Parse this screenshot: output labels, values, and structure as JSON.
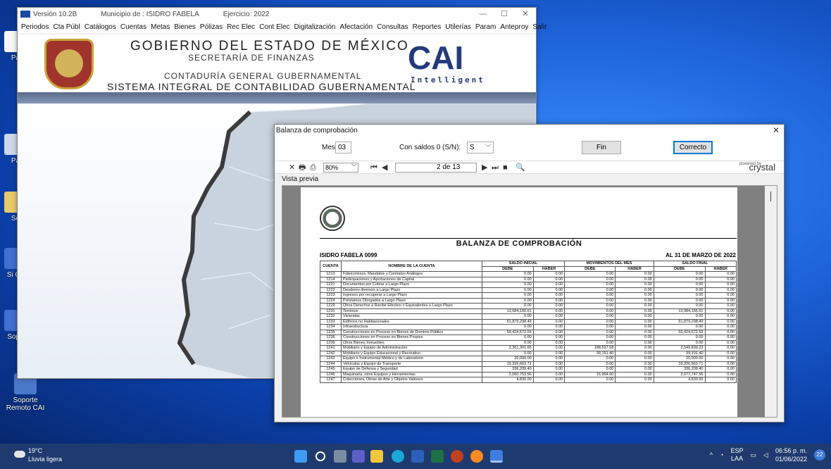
{
  "main_window": {
    "version": "Versión 10.2B",
    "municipio": "Municipio de : ISIDRO FABELA",
    "ejercicio": "Ejercicio: 2022",
    "menu": [
      "Periodos",
      "Cta Públ",
      "Catálogos",
      "Cuentas",
      "Metas",
      "Bienes",
      "Pólizas",
      "Rec Elec",
      "Cont Elec",
      "Digitalización",
      "Afectación",
      "Consultas",
      "Reportes",
      "Utilerías",
      "Param",
      "Anteproy",
      "Salir"
    ],
    "banner": {
      "line1": "GOBIERNO DEL ESTADO DE MÉXICO",
      "line2": "SECRETARÍA DE FINANZAS",
      "line3": "CONTADURÍA GENERAL GUBERNAMENTAL",
      "line4": "SISTEMA INTEGRAL DE CONTABILIDAD GUBERNAMENTAL",
      "logo": "CAI",
      "logo_sub": "Intelligent"
    }
  },
  "dialog": {
    "title": "Balanza de comprobación",
    "mes_label": "Mes:",
    "mes_value": "03",
    "saldos_label": "Con saldos 0 (S/N):",
    "saldos_value": "S",
    "fin_label": "Fin",
    "correcto_label": "Correcto",
    "zoom": "80%",
    "page_current": "2",
    "page_total": "de 13",
    "crystal": "crystal",
    "powered_by": "powered by",
    "vista_previa": "Vista previa"
  },
  "report": {
    "title": "BALANZA DE COMPROBACIÓN",
    "municipio": "ISIDRO FABELA 0099",
    "date": "AL 31 DE MARZO DE 2022",
    "headers": {
      "cuenta": "CUENTA",
      "nombre": "NOMBRE DE LA CUENTA",
      "saldo_inicial": "SALDO INICIAL",
      "movimientos": "MOVIMIENTOS DEL MES",
      "saldo_final": "SALDO FINAL",
      "debe": "DEBE",
      "haber": "HABER"
    },
    "rows": [
      [
        "1213",
        "Fideicomisos, Mandatos y Contratos Análogos",
        "0.00",
        "0.00",
        "0.00",
        "0.00",
        "0.00",
        "0.00"
      ],
      [
        "1214",
        "Participaciones y Aportaciones de Capital",
        "0.00",
        "0.00",
        "0.00",
        "0.00",
        "0.00",
        "0.00"
      ],
      [
        "1221",
        "Documentos por Cobrar a Largo Plazo",
        "0.00",
        "0.00",
        "0.00",
        "0.00",
        "0.00",
        "0.00"
      ],
      [
        "1222",
        "Deudores diversos a Largo Plazo",
        "0.00",
        "0.00",
        "0.00",
        "0.00",
        "0.00",
        "0.00"
      ],
      [
        "1223",
        "Ingresos por recuperar a Largo Plazo",
        "0.00",
        "0.00",
        "0.00",
        "0.00",
        "0.00",
        "0.00"
      ],
      [
        "1224",
        "Préstamos Otorgados a Largo Plazo",
        "0.00",
        "0.00",
        "0.00",
        "0.00",
        "0.00",
        "0.00"
      ],
      [
        "1229",
        "Otros Derechos a Recibir Efectivo o Equivalentes a Largo Plazo",
        "0.00",
        "0.00",
        "0.00",
        "0.00",
        "0.00",
        "0.00"
      ],
      [
        "1231",
        "Terrenos",
        "13,084,156.61",
        "0.00",
        "0.00",
        "0.00",
        "13,084,156.61",
        "0.00"
      ],
      [
        "1232",
        "Viviendas",
        "0.00",
        "0.00",
        "0.00",
        "0.00",
        "0.00",
        "0.00"
      ],
      [
        "1233",
        "Edificios no Habitacionales",
        "51,879,298.49",
        "0.00",
        "0.00",
        "0.00",
        "51,879,298.49",
        "0.00"
      ],
      [
        "1234",
        "Infraestructura",
        "0.00",
        "0.00",
        "0.00",
        "0.00",
        "0.00",
        "0.00"
      ],
      [
        "1235",
        "Construcciones en Proceso en Bienes de Dominio Público",
        "59,424,672.59",
        "0.00",
        "0.00",
        "0.00",
        "59,424,672.59",
        "0.00"
      ],
      [
        "1236",
        "Construcciones en Proceso en Bienes Propios",
        "0.00",
        "0.00",
        "0.00",
        "0.00",
        "0.00",
        "0.00"
      ],
      [
        "1239",
        "Otros Bienes Inmuebles",
        "0.00",
        "0.00",
        "0.00",
        "0.00",
        "0.00",
        "0.00"
      ],
      [
        "1241",
        "Mobiliario y Equipo de Administración",
        "2,361,301.65",
        "0.00",
        "188,537.58",
        "0.00",
        "2,549,839.23",
        "0.00"
      ],
      [
        "1242",
        "Mobiliario y Equipo Educacional y Recreativo",
        "0.00",
        "0.00",
        "39,191.40",
        "0.00",
        "39,191.40",
        "0.00"
      ],
      [
        "1243",
        "Equipo e Instrumental Médico y de Laboratorio",
        "20,000.00",
        "0.00",
        "0.00",
        "0.00",
        "20,000.00",
        "0.00"
      ],
      [
        "1244",
        "Vehículos y Equipo de Transporte",
        "19,326,663.71",
        "0.00",
        "0.00",
        "0.00",
        "19,326,663.71",
        "0.00"
      ],
      [
        "1245",
        "Equipo de Defensa y Seguridad",
        "336,209.40",
        "0.00",
        "0.00",
        "0.00",
        "336,209.40",
        "0.00"
      ],
      [
        "1246",
        "Maquinaria, otros Equipos y Herramientas",
        "2,060,753.56",
        "0.00",
        "16,994.00",
        "0.00",
        "2,077,747.56",
        "0.00"
      ],
      [
        "1247",
        "Colecciones, Obras de Arte y Objetos Valiosos",
        "4,830.00",
        "0.00",
        "0.00",
        "0.00",
        "4,830.00",
        "0.00"
      ]
    ]
  },
  "desktop_icons": [
    "Pa",
    "Pa",
    "Se",
    "Si Co",
    "Sopo",
    "Soporte Remoto CAI"
  ],
  "taskbar": {
    "temp": "19°C",
    "weather": "Lluvia ligera",
    "lang": "ESP",
    "lang2": "LAA",
    "time": "06:56 p. m.",
    "date": "01/06/2022",
    "notifications": "22"
  }
}
